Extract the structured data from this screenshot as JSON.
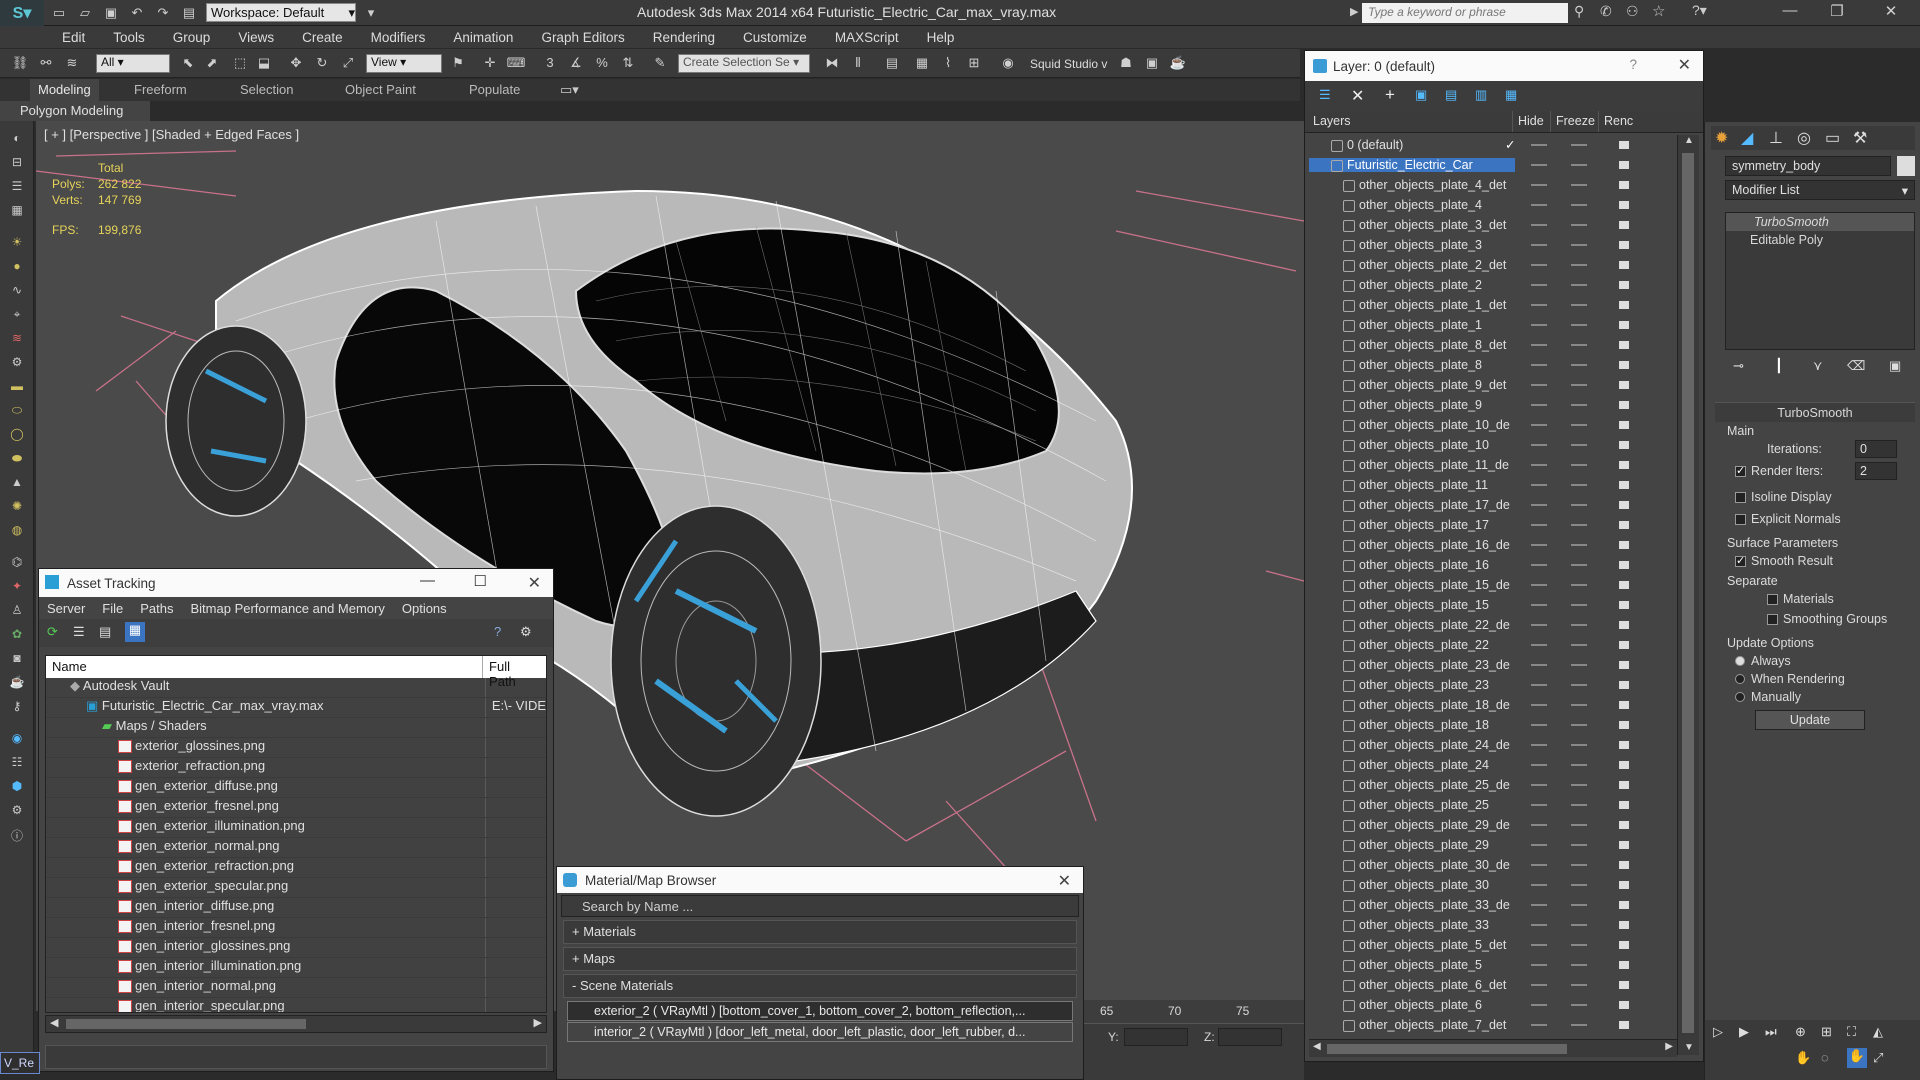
{
  "titlebar": {
    "workspace_label": "Workspace: Default",
    "title": "Autodesk 3ds Max  2014 x64    Futuristic_Electric_Car_max_vray.max",
    "search_placeholder": "Type a keyword or phrase"
  },
  "menu": [
    "Edit",
    "Tools",
    "Group",
    "Views",
    "Create",
    "Modifiers",
    "Animation",
    "Graph Editors",
    "Rendering",
    "Customize",
    "MAXScript",
    "Help"
  ],
  "toolbar": {
    "filter_value": "All",
    "refcoord_value": "View",
    "selection_set_placeholder": "Create Selection Se",
    "plugin_label": "Squid Studio v"
  },
  "ribbon": {
    "tabs": [
      "Modeling",
      "Freeform",
      "Selection",
      "Object Paint",
      "Populate"
    ],
    "sub_label": "Polygon Modeling"
  },
  "viewport": {
    "label": "[ + ] [Perspective ] [Shaded + Edged Faces ]",
    "stats": {
      "total_label": "Total",
      "polys_label": "Polys:",
      "polys_value": "262 822",
      "verts_label": "Verts:",
      "verts_value": "147 769",
      "fps_label": "FPS:",
      "fps_value": "199,876"
    }
  },
  "asset_tracking": {
    "title": "Asset Tracking",
    "menu": [
      "Server",
      "File",
      "Paths",
      "Bitmap Performance and Memory",
      "Options"
    ],
    "columns": [
      "Name",
      "Full Path"
    ],
    "rows": [
      {
        "name": "Autodesk Vault",
        "path": "",
        "indent": 0
      },
      {
        "name": "Futuristic_Electric_Car_max_vray.max",
        "path": "E:\\- VIDE",
        "indent": 1
      },
      {
        "name": "Maps / Shaders",
        "path": "",
        "indent": 2
      },
      {
        "name": "exterior_glossines.png",
        "path": "",
        "indent": 3
      },
      {
        "name": "exterior_refraction.png",
        "path": "",
        "indent": 3
      },
      {
        "name": "gen_exterior_diffuse.png",
        "path": "",
        "indent": 3
      },
      {
        "name": "gen_exterior_fresnel.png",
        "path": "",
        "indent": 3
      },
      {
        "name": "gen_exterior_illumination.png",
        "path": "",
        "indent": 3
      },
      {
        "name": "gen_exterior_normal.png",
        "path": "",
        "indent": 3
      },
      {
        "name": "gen_exterior_refraction.png",
        "path": "",
        "indent": 3
      },
      {
        "name": "gen_exterior_specular.png",
        "path": "",
        "indent": 3
      },
      {
        "name": "gen_interior_diffuse.png",
        "path": "",
        "indent": 3
      },
      {
        "name": "gen_interior_fresnel.png",
        "path": "",
        "indent": 3
      },
      {
        "name": "gen_interior_glossines.png",
        "path": "",
        "indent": 3
      },
      {
        "name": "gen_interior_illumination.png",
        "path": "",
        "indent": 3
      },
      {
        "name": "gen_interior_normal.png",
        "path": "",
        "indent": 3
      },
      {
        "name": "gen_interior_specular.png",
        "path": "",
        "indent": 3
      }
    ]
  },
  "material_browser": {
    "title": "Material/Map Browser",
    "search_placeholder": "Search by Name ...",
    "groups": [
      "+ Materials",
      "+ Maps",
      "- Scene Materials"
    ],
    "items": [
      "exterior_2 ( VRayMtl ) [bottom_cover_1, bottom_cover_2, bottom_reflection,...",
      "interior_2 ( VRayMtl ) [door_left_metal, door_left_plastic, door_left_rubber, d..."
    ]
  },
  "timeline": {
    "ticks": [
      "65",
      "70",
      "75"
    ],
    "y_label": "Y:",
    "z_label": "Z:"
  },
  "layers": {
    "title": "Layer: 0 (default)",
    "columns": [
      "Layers",
      "Hide",
      "Freeze",
      "Renc"
    ],
    "rows": [
      "0 (default)",
      "Futuristic_Electric_Car",
      "other_objects_plate_4_det",
      "other_objects_plate_4",
      "other_objects_plate_3_det",
      "other_objects_plate_3",
      "other_objects_plate_2_det",
      "other_objects_plate_2",
      "other_objects_plate_1_det",
      "other_objects_plate_1",
      "other_objects_plate_8_det",
      "other_objects_plate_8",
      "other_objects_plate_9_det",
      "other_objects_plate_9",
      "other_objects_plate_10_de",
      "other_objects_plate_10",
      "other_objects_plate_11_de",
      "other_objects_plate_11",
      "other_objects_plate_17_de",
      "other_objects_plate_17",
      "other_objects_plate_16_de",
      "other_objects_plate_16",
      "other_objects_plate_15_de",
      "other_objects_plate_15",
      "other_objects_plate_22_de",
      "other_objects_plate_22",
      "other_objects_plate_23_de",
      "other_objects_plate_23",
      "other_objects_plate_18_de",
      "other_objects_plate_18",
      "other_objects_plate_24_de",
      "other_objects_plate_24",
      "other_objects_plate_25_de",
      "other_objects_plate_25",
      "other_objects_plate_29_de",
      "other_objects_plate_29",
      "other_objects_plate_30_de",
      "other_objects_plate_30",
      "other_objects_plate_33_de",
      "other_objects_plate_33",
      "other_objects_plate_5_det",
      "other_objects_plate_5",
      "other_objects_plate_6_det",
      "other_objects_plate_6",
      "other_objects_plate_7_det"
    ]
  },
  "command_panel": {
    "object_name": "symmetry_body",
    "modifier_list": "Modifier List",
    "stack": [
      "TurboSmooth",
      "Editable Poly"
    ],
    "rollout_title": "TurboSmooth",
    "main_label": "Main",
    "iterations_label": "Iterations:",
    "iterations_value": "0",
    "render_iters_label": "Render Iters:",
    "render_iters_value": "2",
    "isoline_label": "Isoline Display",
    "explicit_label": "Explicit Normals",
    "surface_label": "Surface Parameters",
    "smooth_label": "Smooth Result",
    "separate_label": "Separate",
    "materials_label": "Materials",
    "smoothing_label": "Smoothing Groups",
    "update_options_label": "Update Options",
    "always_label": "Always",
    "when_rendering_label": "When Rendering",
    "manually_label": "Manually",
    "update_button": "Update"
  },
  "status": {
    "script_label": "V_Re"
  },
  "colors": {
    "accent": "#3b74c0",
    "stats": "#e6d35a",
    "wheel_accent": "#3aa0d8"
  }
}
